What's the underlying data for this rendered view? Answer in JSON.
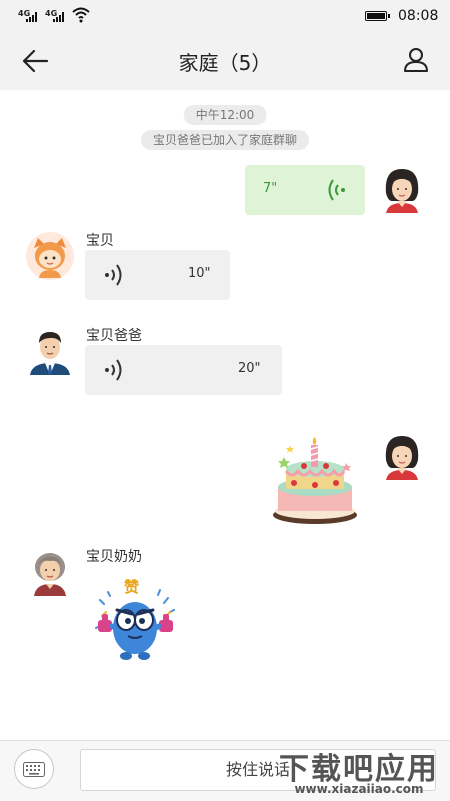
{
  "status_bar": {
    "signal_1": "4G",
    "signal_2": "4G",
    "time": "08:08"
  },
  "header": {
    "title": "家庭（5）"
  },
  "system_messages": {
    "time": "中午12:00",
    "join_notice": "宝贝爸爸已加入了家庭群聊"
  },
  "messages": [
    {
      "sender": "me",
      "type": "voice",
      "duration": "7\""
    },
    {
      "sender": "宝贝",
      "type": "voice",
      "duration": "10\""
    },
    {
      "sender": "宝贝爸爸",
      "type": "voice",
      "duration": "20\""
    },
    {
      "sender": "me",
      "type": "sticker",
      "sticker": "birthday-cake"
    },
    {
      "sender": "宝贝奶奶",
      "type": "sticker",
      "sticker": "zan-monster",
      "sticker_text": "赞"
    }
  ],
  "input_bar": {
    "hold_to_talk": "按住说话"
  },
  "watermark": {
    "text": "下载吧应用",
    "url": "www.xiazaiiao.com"
  },
  "colors": {
    "voice_out_bubble": "#dff3d7",
    "voice_out_text": "#3a9a3a",
    "voice_in_bubble": "#f0f0f0"
  }
}
